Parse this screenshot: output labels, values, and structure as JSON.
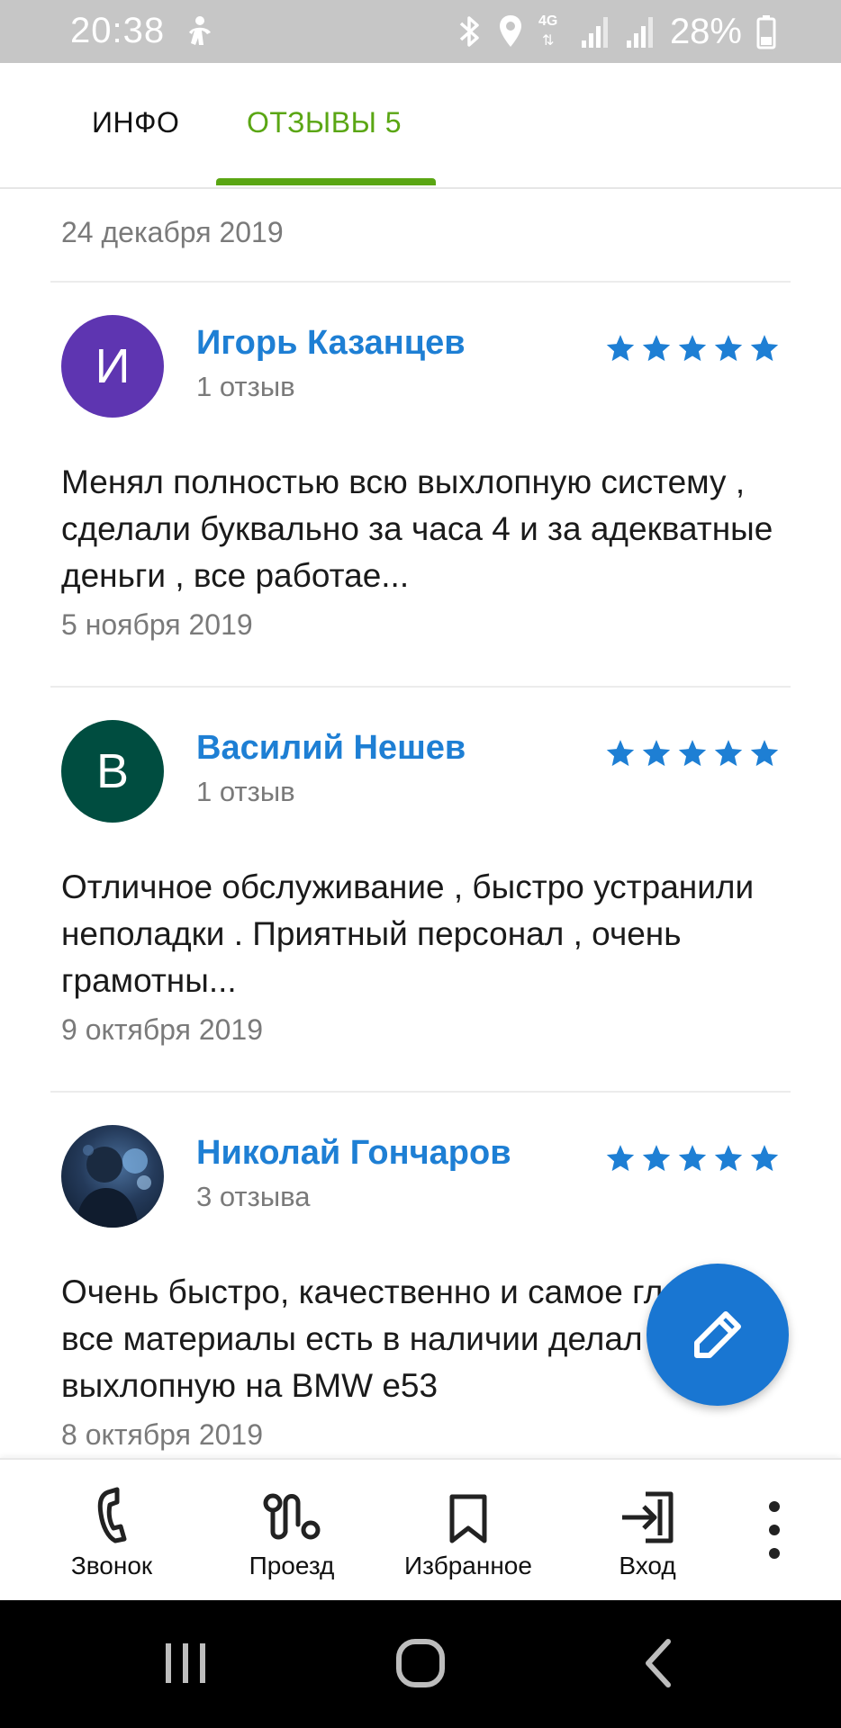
{
  "status_bar": {
    "time": "20:38",
    "network": "4G",
    "battery": "28%"
  },
  "tabs": {
    "info_label": "ИНФО",
    "reviews_label": "ОТЗЫВЫ 5",
    "active_color": "#5aa613"
  },
  "top_date": "24 декабря 2019",
  "reviews": [
    {
      "initial": "И",
      "avatar_color": "#5e35b1",
      "name": "Игорь Казанцев",
      "count": "1 отзыв",
      "rating": 5,
      "text": "Менял полностью всю выхлопную систему , сделали буквально за часа 4 и за адекватные деньги , все работае...",
      "date": "5 ноября 2019"
    },
    {
      "initial": "В",
      "avatar_color": "#004d40",
      "name": "Василий Нешев",
      "count": "1 отзыв",
      "rating": 5,
      "text": "Отличное обслуживание , быстро устранили неполадки . Приятный персонал , очень грамотны...",
      "date": "9 октября 2019"
    },
    {
      "initial": "",
      "avatar_color": "#1c2f4a",
      "name": "Николай Гончаров",
      "count": "3 отзыва",
      "rating": 5,
      "text": "Очень быстро, качественно и самое главное все материалы есть в наличии делал выхлопную на BMW e53",
      "date": "8 октября 2019"
    }
  ],
  "star_color": "#1e7fd4",
  "fab": {
    "icon": "pencil-icon",
    "color": "#1976d2"
  },
  "bottom_nav": {
    "call_label": "Звонок",
    "route_label": "Проезд",
    "favorites_label": "Избранное",
    "login_label": "Вход"
  }
}
